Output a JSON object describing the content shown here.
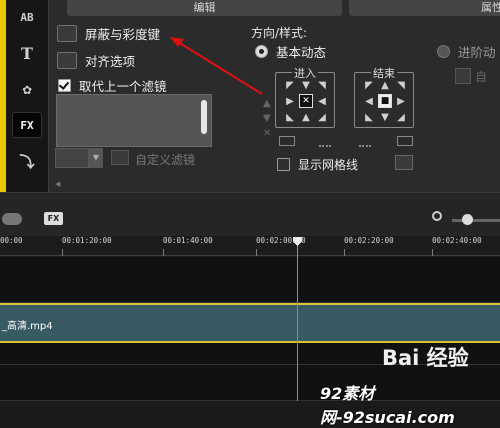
{
  "tabs": {
    "edit": "编辑",
    "attributes": "属性"
  },
  "tools": [
    {
      "label": "AB",
      "name": "title-tool"
    },
    {
      "label": "T",
      "name": "text-tool"
    },
    {
      "label": "✿",
      "name": "graphics-tool"
    },
    {
      "label": "FX",
      "name": "filter-tool"
    },
    {
      "label": "⤵",
      "name": "path-tool"
    }
  ],
  "options": {
    "mask_chroma_key": "屏蔽与彩度键",
    "align_options": "对齐选项",
    "replace_last_filter": "取代上一个滤镜",
    "replace_last_filter_checked": true,
    "custom_filter": "自定义滤镜"
  },
  "direction": {
    "heading": "方向/样式:",
    "basic_motion": "基本动态",
    "advanced_motion": "进阶动",
    "enter_label": "进入",
    "exit_label": "结束",
    "show_grid": "显示网格线",
    "auto_label": "自"
  },
  "timeline": {
    "ruler_ticks": [
      "00:00",
      "00:01:20:00",
      "00:01:40:00",
      "00:02:00:00",
      "00:02:20:00",
      "00:02:40:00"
    ],
    "clip_name": "_高清.mp4",
    "fx_badge": "FX"
  },
  "watermarks": {
    "top": "Bai 经验",
    "bottom": "92素材网-92sucai.com"
  },
  "colors": {
    "accent_yellow": "#e8c600",
    "clip": "#385a63",
    "playhead": "#6c8fd8",
    "annotation": "#e01010"
  }
}
